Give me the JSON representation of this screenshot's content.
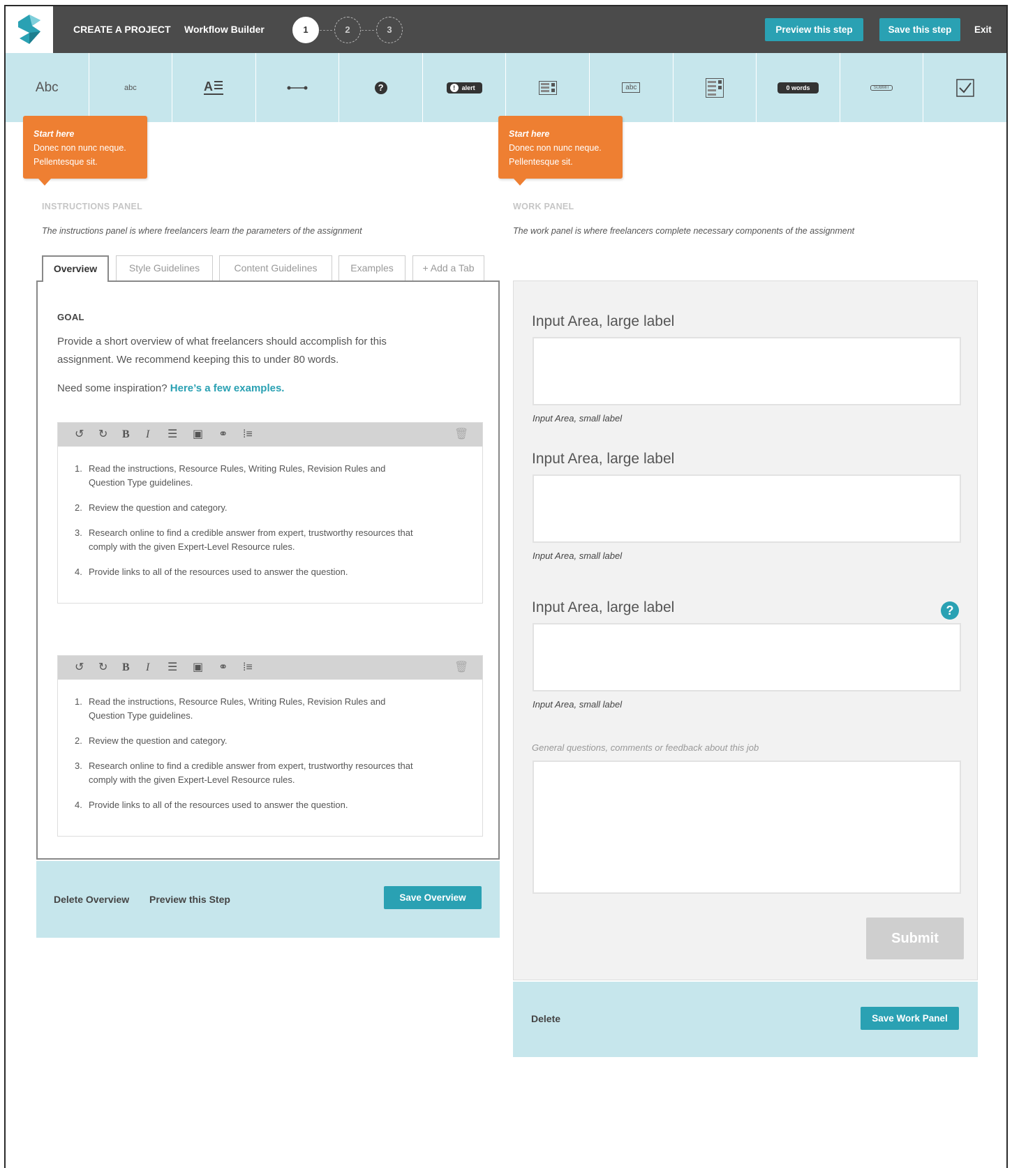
{
  "header": {
    "project_title": "CREATE A PROJECT",
    "builder_title": "Workflow Builder",
    "steps": [
      "1",
      "2",
      "3"
    ],
    "preview_label": "Preview this step",
    "save_label": "Save this step",
    "exit_label": "Exit"
  },
  "toolbar": {
    "tools": [
      {
        "name": "heading-text",
        "text": "Abc"
      },
      {
        "name": "body-text",
        "text": "abc"
      },
      {
        "name": "paragraph-text",
        "text": "A"
      },
      {
        "name": "divider",
        "text": ""
      },
      {
        "name": "help",
        "text": "?"
      },
      {
        "name": "alert",
        "text": "alert"
      },
      {
        "name": "form-grid",
        "text": ""
      },
      {
        "name": "text-input",
        "text": "abc"
      },
      {
        "name": "form-columns",
        "text": ""
      },
      {
        "name": "word-count",
        "text": "0 words"
      },
      {
        "name": "submit-button",
        "text": "SUBMIT"
      },
      {
        "name": "checkbox",
        "text": ""
      }
    ]
  },
  "callouts": {
    "left": {
      "title": "Start here",
      "line1": "Donec non nunc neque.",
      "line2": "Pellentesque sit."
    },
    "right": {
      "title": "Start here",
      "line1": "Donec non nunc neque.",
      "line2": "Pellentesque sit."
    }
  },
  "instructions": {
    "label": "INSTRUCTIONS PANEL",
    "description": "The instructions panel is where freelancers learn the parameters of the assignment",
    "tabs": [
      "Overview",
      "Style Guidelines",
      "Content Guidelines",
      "Examples",
      "+ Add a Tab"
    ],
    "goal_heading": "GOAL",
    "goal_text": "Provide a short overview of what freelancers should accomplish for this assignment. We recommend keeping this to under 80 words.",
    "inspiration_text": "Need some inspiration? ",
    "inspiration_link": "Here’s a few examples.",
    "editor_items": [
      {
        "num": "1.",
        "text": "Read the instructions, Resource Rules, Writing Rules, Revision Rules and Question Type guidelines."
      },
      {
        "num": "2.",
        "text": "Review the question and category."
      },
      {
        "num": "3.",
        "text": "Research online to find a credible answer from expert, trustworthy resources that comply with the given Expert-Level Resource rules."
      },
      {
        "num": "4.",
        "text": "Provide links to all of the resources used to answer the question."
      }
    ],
    "footer": {
      "delete_label": "Delete Overview",
      "preview_label": "Preview this Step",
      "save_label": "Save Overview"
    }
  },
  "work": {
    "label": "WORK PANEL",
    "description": "The work panel is where freelancers complete necessary components of the assignment",
    "large_label": "Input Area, large label",
    "small_label": "Input Area, small label",
    "comments_label": "General questions, comments or feedback about this job",
    "submit_label": "Submit",
    "help_glyph": "?",
    "footer": {
      "delete_label": "Delete",
      "save_label": "Save Work Panel"
    }
  },
  "colors": {
    "accent": "#2aa1b3",
    "callout": "#ee7f32",
    "toolbar_bg": "#c6e6ec",
    "topbar_bg": "#4b4b4b"
  }
}
